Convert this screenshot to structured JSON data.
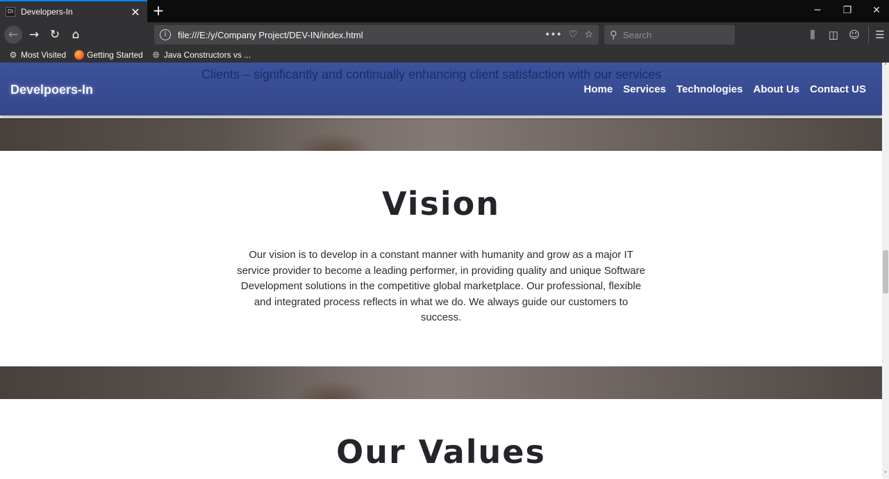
{
  "browser": {
    "tab_title": "Developers-In",
    "tab_favicon": "DI",
    "url": "file:///E:/y/Company Project/DEV-IN/index.html",
    "search_placeholder": "Search",
    "bookmarks": [
      {
        "label": "Most Visited",
        "icon": "gear-icon"
      },
      {
        "label": "Getting Started",
        "icon": "firefox-icon"
      },
      {
        "label": "Java Constructors vs ...",
        "icon": "globe-icon"
      }
    ]
  },
  "site": {
    "marquee": "Clients – significantly and continually enhancing client satisfaction with our services",
    "brand": "Develpoers-In",
    "nav": [
      "Home",
      "Services",
      "Technologies",
      "About Us",
      "Contact US"
    ],
    "accent": "#3a4f98"
  },
  "vision": {
    "title": "Vision",
    "text": "Our vision is to develop in a constant manner with humanity and grow as a major IT service provider to become a leading performer, in providing quality and unique Software Development solutions in the competitive global marketplace. Our professional, flexible and integrated process reflects in what we do. We always guide our customers to success."
  },
  "values": {
    "title": "Our Values"
  }
}
